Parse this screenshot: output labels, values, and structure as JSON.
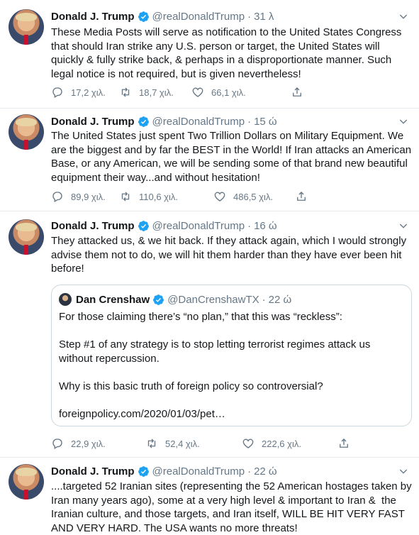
{
  "tweets": [
    {
      "name": "Donald J. Trump",
      "handle": "@realDonaldTrump",
      "separator": "·",
      "time": "31 λ",
      "text": "These Media Posts will serve as notification to the United States Congress that should Iran strike any U.S. person or target, the United States will quickly & fully strike back, & perhaps in a disproportionate manner. Such legal notice is not required, but is given nevertheless!",
      "replies": "17,2 χιλ.",
      "retweets": "18,7 χιλ.",
      "likes": "66,1 χιλ."
    },
    {
      "name": "Donald J. Trump",
      "handle": "@realDonaldTrump",
      "separator": "·",
      "time": "15 ώ",
      "text": "The United States just spent Two Trillion Dollars on Military Equipment. We are the biggest and by far the BEST in the World! If Iran attacks an American Base, or any American, we will be sending some of that brand new beautiful equipment their way...and without hesitation!",
      "replies": "89,9 χιλ.",
      "retweets": "110,6 χιλ.",
      "likes": "486,5 χιλ."
    },
    {
      "name": "Donald J. Trump",
      "handle": "@realDonaldTrump",
      "separator": "·",
      "time": "16 ώ",
      "text": "They attacked us, & we hit back. If they attack again, which I would strongly advise them not to do, we will hit them harder than they have ever been hit before!",
      "replies": "22,9 χιλ.",
      "retweets": "52,4 χιλ.",
      "likes": "222,6 χιλ.",
      "quote": {
        "name": "Dan Crenshaw",
        "handle": "@DanCrenshawTX",
        "separator": "·",
        "time": "22 ώ",
        "text": "For those claiming there’s “no plan,” that this was “reckless”:\n\nStep #1 of any strategy is to stop letting terrorist regimes attack us without repercussion.\n\nWhy is this basic truth of foreign policy so controversial?\n\nforeignpolicy.com/2020/01/03/pet…"
      }
    },
    {
      "name": "Donald J. Trump",
      "handle": "@realDonaldTrump",
      "separator": "·",
      "time": "22 ώ",
      "text": "....targeted 52 Iranian sites (representing the 52 American hostages taken by Iran many years ago), some at a very high level & important to Iran &  the Iranian culture, and those targets, and Iran itself, WILL BE HIT VERY FAST AND VERY HARD. The USA wants no more threats!"
    }
  ],
  "colors": {
    "verified": "#1da1f2",
    "muted": "#657786",
    "divider": "#e6ecf0"
  },
  "icons": [
    "verified-badge-icon",
    "chevron-down-icon",
    "reply-icon",
    "retweet-icon",
    "like-icon",
    "share-icon"
  ]
}
